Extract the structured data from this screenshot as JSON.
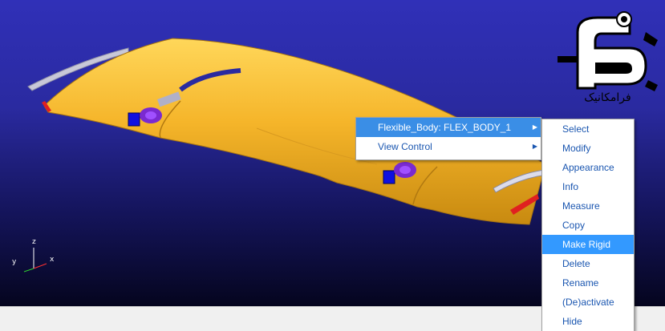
{
  "logo": {
    "text": "فرامکانیک"
  },
  "axes": {
    "z": "z",
    "y": "y",
    "x": "x"
  },
  "context_menu": {
    "items": [
      {
        "label": "Flexible_Body: FLEX_BODY_1",
        "has_submenu": true,
        "highlighted": true
      },
      {
        "label": "View Control",
        "has_submenu": true,
        "highlighted": false
      }
    ]
  },
  "submenu": {
    "items": [
      {
        "label": "Select",
        "highlighted": false
      },
      {
        "label": "Modify",
        "highlighted": false
      },
      {
        "label": "Appearance",
        "highlighted": false
      },
      {
        "label": "Info",
        "highlighted": false
      },
      {
        "label": "Measure",
        "highlighted": false
      },
      {
        "label": "Copy",
        "highlighted": false
      },
      {
        "label": "Make Rigid",
        "highlighted": true
      },
      {
        "label": "Delete",
        "highlighted": false
      },
      {
        "label": "Rename",
        "highlighted": false
      },
      {
        "label": "(De)activate",
        "highlighted": false
      },
      {
        "label": "Hide",
        "highlighted": false
      }
    ]
  },
  "icons": {
    "submenu_arrow": "chevron-right-icon"
  },
  "colors": {
    "wing": "#f5b52a",
    "menu_highlight": "#3399ff",
    "menu_text": "#1a56b0",
    "background_top": "#3030b8"
  }
}
